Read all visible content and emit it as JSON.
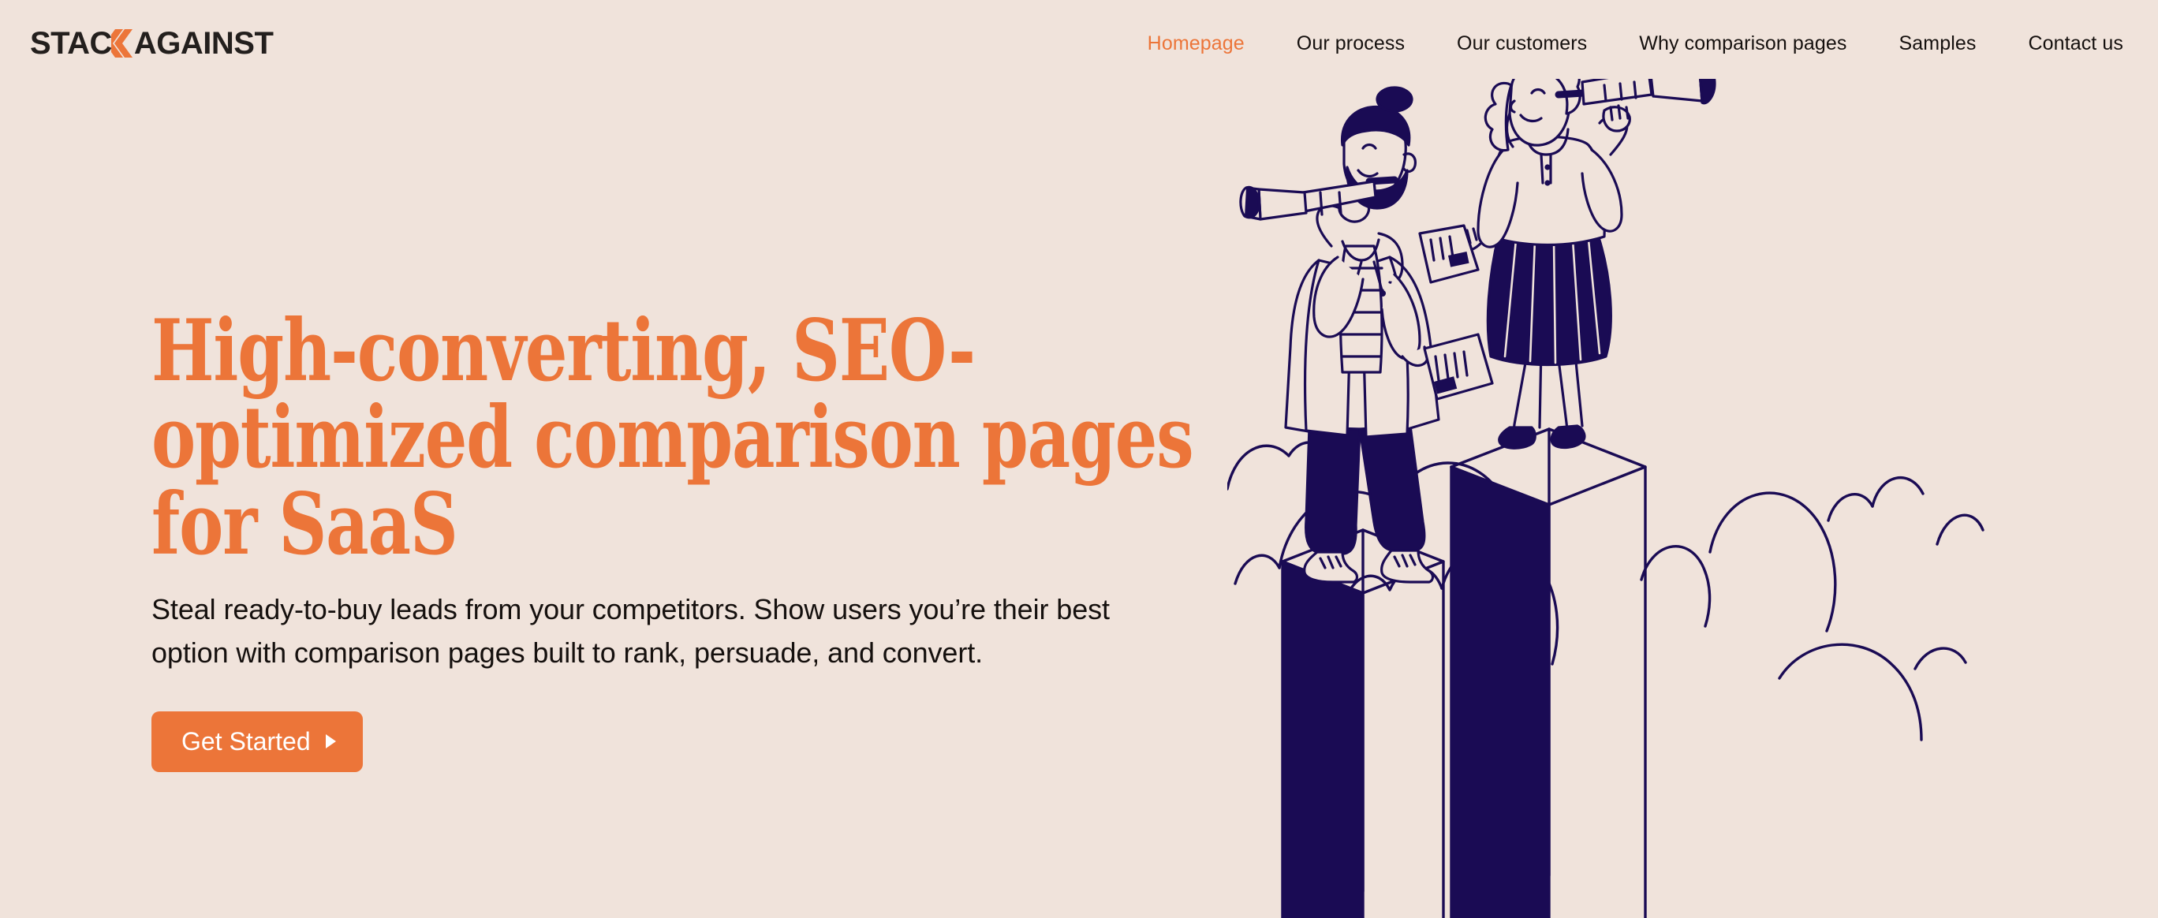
{
  "brand": {
    "name_part1": "STAC",
    "chevron_icon": "double-chevron-left-icon",
    "name_part2": "AGAINST",
    "full_name": "STACKAGAINST",
    "text_color": "#231F1D",
    "accent_color": "#EC7539"
  },
  "theme": {
    "background": "#F0E3DB",
    "accent_orange": "#EC7539",
    "ink_navy": "#1A0B54",
    "text_dark": "#15100E"
  },
  "nav": {
    "items": [
      {
        "label": "Homepage",
        "active": true
      },
      {
        "label": "Our process",
        "active": false
      },
      {
        "label": "Our customers",
        "active": false
      },
      {
        "label": "Why comparison pages",
        "active": false
      },
      {
        "label": "Samples",
        "active": false
      },
      {
        "label": "Contact us",
        "active": false
      }
    ]
  },
  "hero": {
    "title": "High-converting, SEO-optimized comparison pages for SaaS",
    "subtitle": "Steal ready-to-buy leads from your competitors. Show users you’re their best option with comparison pages built to rank, persuade, and convert.",
    "cta_label": "Get Started",
    "cta_arrow_icon": "play-triangle-icon",
    "illustration_alt": "two-people-with-telescopes-on-pedestals-illustration"
  }
}
